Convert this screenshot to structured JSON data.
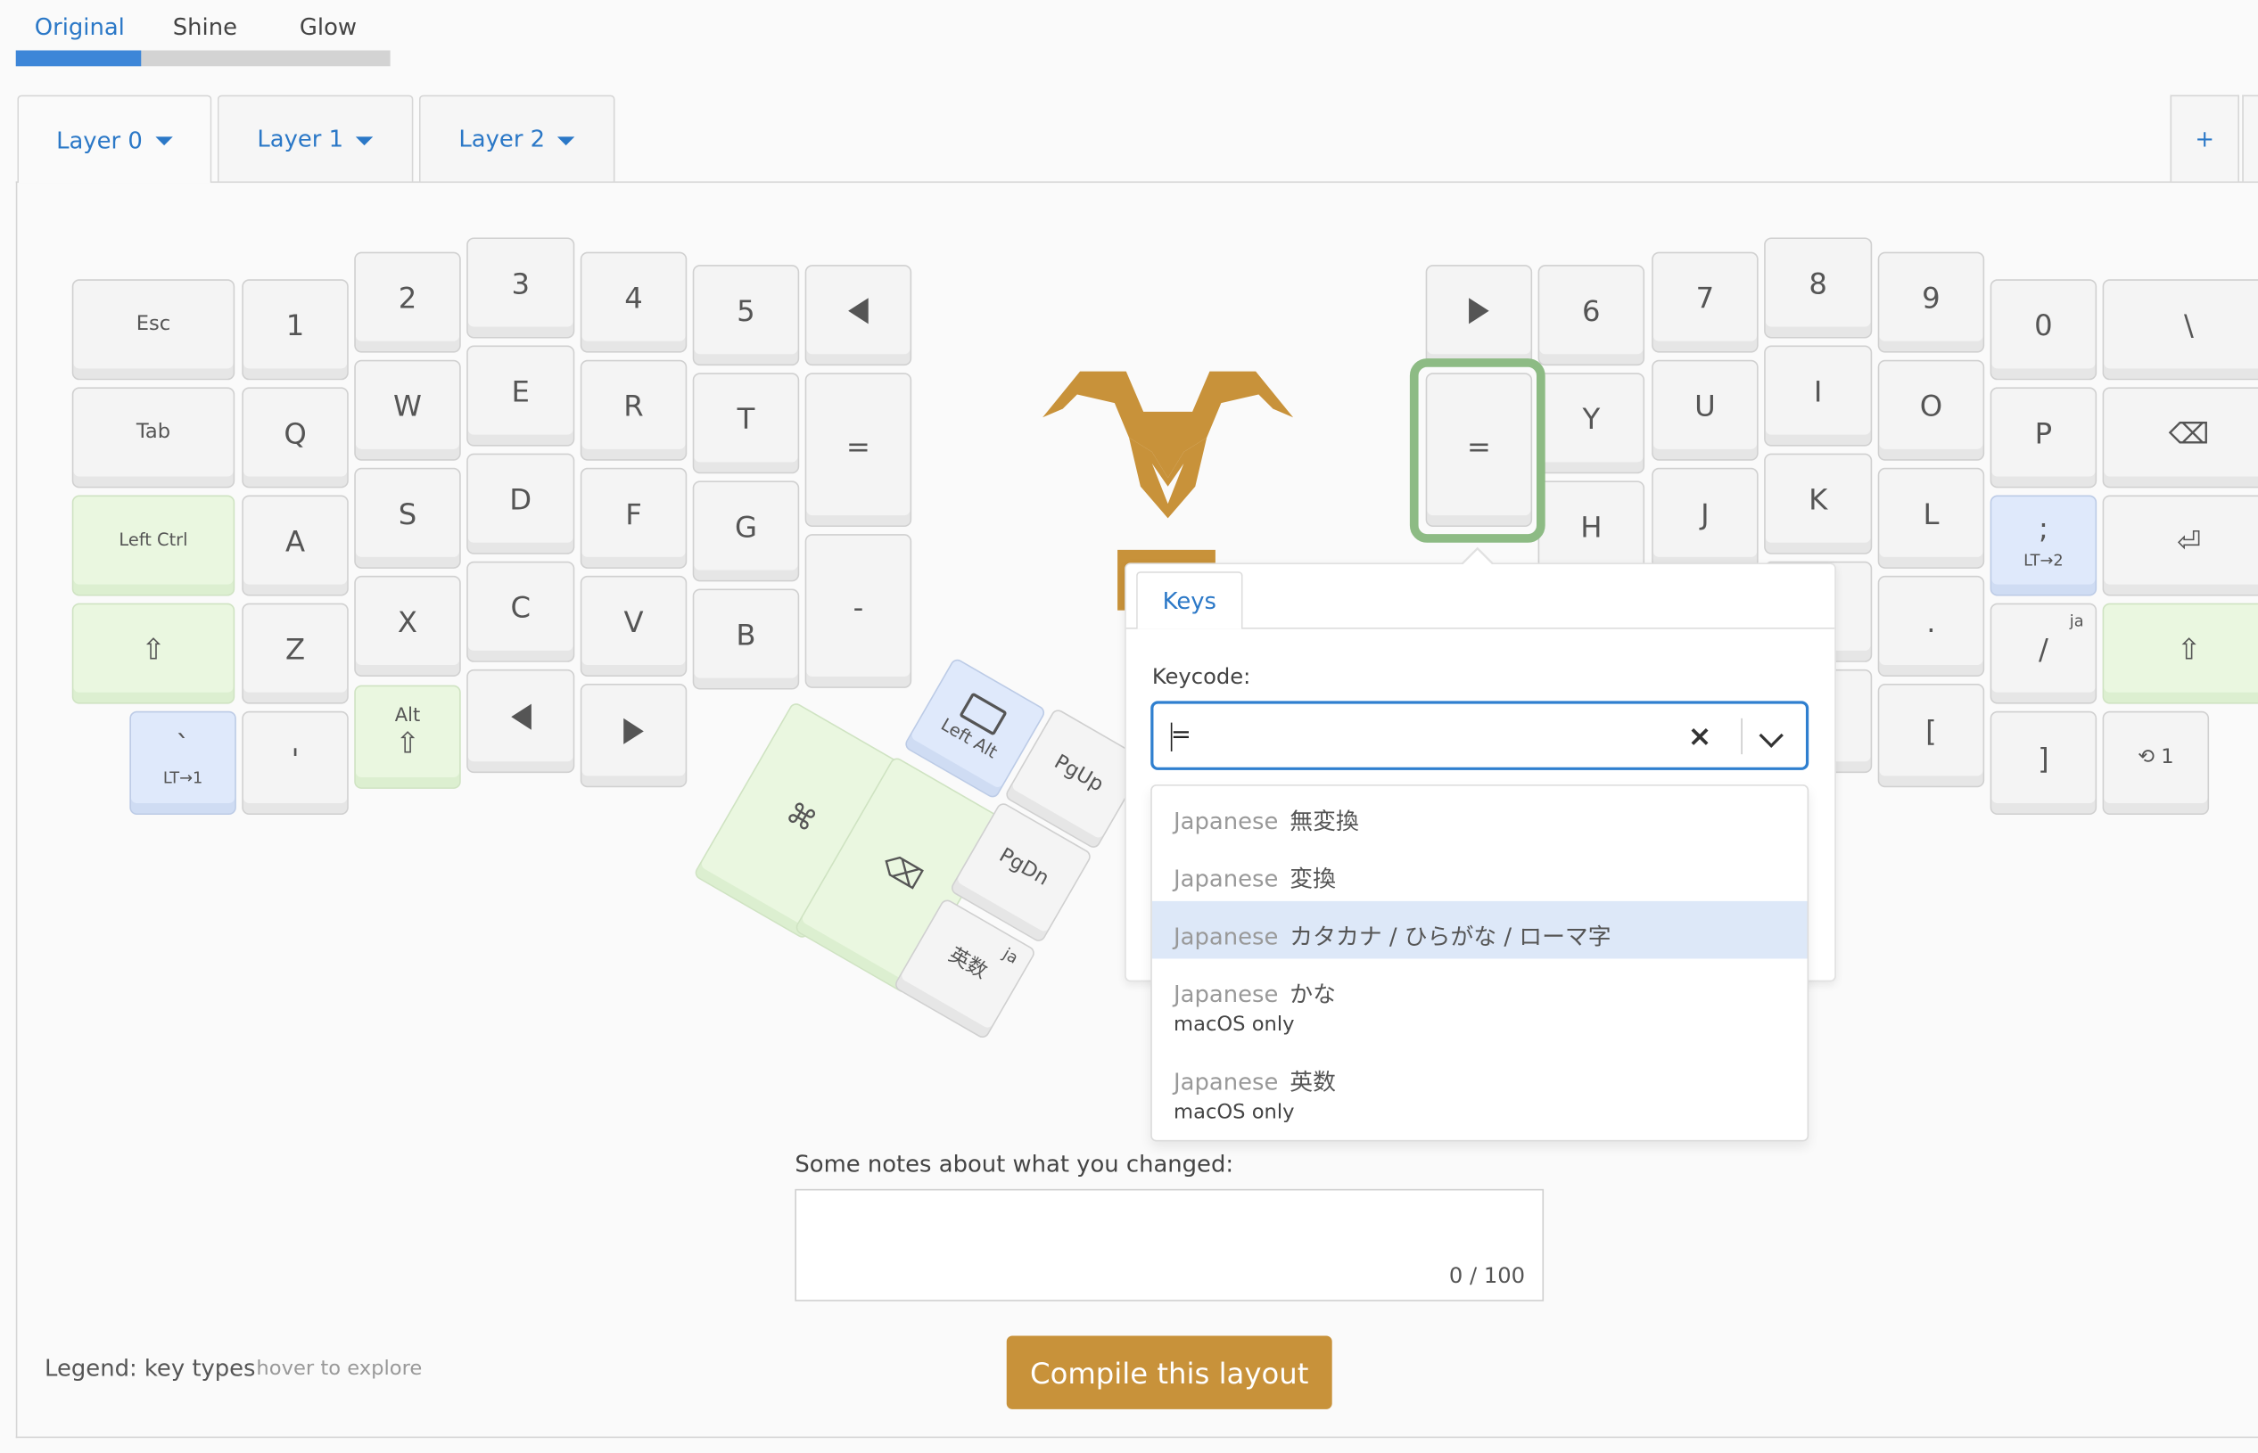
{
  "theme_tabs": [
    "Original",
    "Shine",
    "Glow"
  ],
  "layer_tabs": [
    "Layer 0",
    "Layer 1",
    "Layer 2"
  ],
  "add_layer_label": "+",
  "keys": {
    "esc": "Esc",
    "k1": "1",
    "k2": "2",
    "k3": "3",
    "k4": "4",
    "k5": "5",
    "tab": "Tab",
    "q": "Q",
    "w": "W",
    "e": "E",
    "r": "R",
    "t": "T",
    "eq_left": "=",
    "lctrl": "Left Ctrl",
    "a": "A",
    "s": "S",
    "d": "D",
    "f": "F",
    "g": "G",
    "minus": "-",
    "lshift": "⇧",
    "z": "Z",
    "x": "X",
    "c": "C",
    "v": "V",
    "b": "B",
    "grave": "`",
    "grave_sub": "LT→1",
    "quote": "'",
    "alt": "Alt",
    "alt_sym": "⇧",
    "cmd": "⌘",
    "bksp_thumb": "⌫",
    "leftalt": "Left Alt",
    "pgup": "PgUp",
    "pgdn": "PgDn",
    "eisu": "英数",
    "eisu_sup": "ja",
    "k6": "6",
    "k7": "7",
    "k8": "8",
    "k9": "9",
    "k0": "0",
    "backslash": "\\",
    "eq_right": "=",
    "y": "Y",
    "u": "U",
    "i": "I",
    "o": "O",
    "p": "P",
    "bksp": "⌫",
    "h": "H",
    "j": "J",
    "k": "K",
    "l": "L",
    "semi": ";",
    "semi_sub": "LT→2",
    "enter": "⏎",
    "dot": ".",
    "slash": "/",
    "slash_sup": "ja",
    "rshift": "⇧",
    "lbracket": "[",
    "rbracket": "]",
    "undo_layer": "⟲ 1"
  },
  "popup": {
    "tab": "Keys",
    "keycode_label": "Keycode:",
    "keycode_value": "=",
    "clear": "×",
    "options": [
      {
        "lang": "Japanese",
        "name": "無変換",
        "note": ""
      },
      {
        "lang": "Japanese",
        "name": "変換",
        "note": ""
      },
      {
        "lang": "Japanese",
        "name": "カタカナ / ひらがな / ローマ字",
        "note": ""
      },
      {
        "lang": "Japanese",
        "name": "かな",
        "note": "macOS only"
      },
      {
        "lang": "Japanese",
        "name": "英数",
        "note": "macOS only"
      }
    ]
  },
  "notes": {
    "label": "Some notes about what you changed:",
    "counter": "0 / 100"
  },
  "compile_label": "Compile this layout",
  "legend": {
    "label": "Legend: key types",
    "hint": "hover to explore"
  },
  "colors": {
    "accent": "#2b78c7",
    "brand": "#c8923a",
    "modifier_green": "#eaf7e0",
    "layer_blue": "#dfe9fb",
    "selected": "#8dbb84"
  }
}
